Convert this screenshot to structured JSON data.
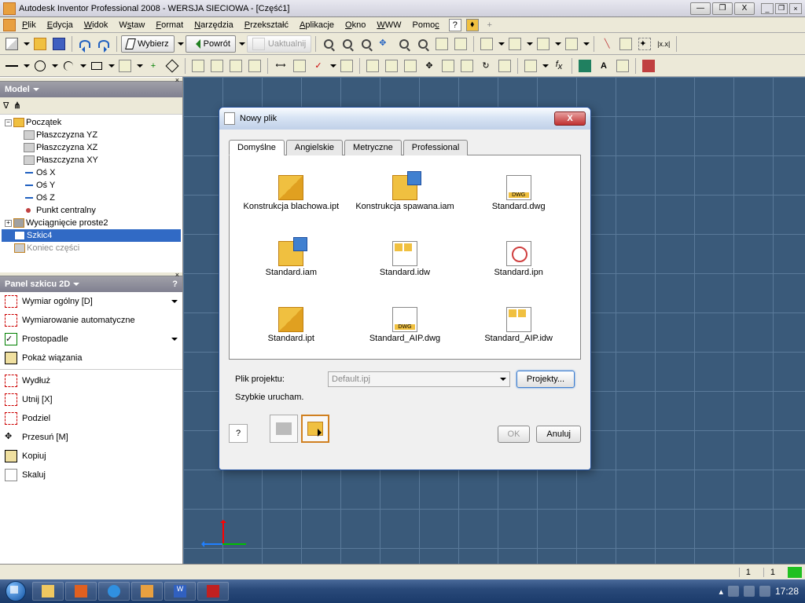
{
  "title": "Autodesk Inventor Professional 2008 - WERSJA SIECIOWA - [Część1]",
  "menus": [
    "Plik",
    "Edycja",
    "Widok",
    "Wstaw",
    "Format",
    "Narzędzia",
    "Przekształć",
    "Aplikacje",
    "Okno",
    "WWW",
    "Pomoc"
  ],
  "toolbar1": {
    "select": "Wybierz",
    "back": "Powrót",
    "update": "Uaktualnij"
  },
  "panels": {
    "model": "Model",
    "sketch": "Panel szkicu 2D"
  },
  "tree": {
    "root": "Początek",
    "items": [
      "Płaszczyzna YZ",
      "Płaszczyzna XZ",
      "Płaszczyzna XY",
      "Oś X",
      "Oś Y",
      "Oś Z",
      "Punkt centralny"
    ],
    "extrude": "Wyciągnięcie proste2",
    "sketch": "Szkic4",
    "last": "Koniec części"
  },
  "tools": {
    "dim": "Wymiar ogólny   [D]",
    "autodim": "Wymiarowanie automatyczne",
    "perp": "Prostopadle",
    "show": "Pokaż wiązania",
    "extend": "Wydłuż",
    "trim": "Utnij   [X]",
    "split": "Podziel",
    "move": "Przesuń   [M]",
    "copy": "Kopiuj",
    "scale": "Skaluj"
  },
  "dialog": {
    "title": "Nowy plik",
    "tabs": [
      "Domyślne",
      "Angielskie",
      "Metryczne",
      "Professional"
    ],
    "files": [
      "Konstrukcja blachowa.ipt",
      "Konstrukcja spawana.iam",
      "Standard.dwg",
      "Standard.iam",
      "Standard.idw",
      "Standard.ipn",
      "Standard.ipt",
      "Standard_AIP.dwg",
      "Standard_AIP.idw"
    ],
    "project_label": "Plik projektu:",
    "project_value": "Default.ipj",
    "projects_btn": "Projekty...",
    "quick_label": "Szybkie urucham.",
    "ok": "OK",
    "cancel": "Anuluj"
  },
  "status": {
    "a": "1",
    "b": "1"
  },
  "clock": "17:28"
}
